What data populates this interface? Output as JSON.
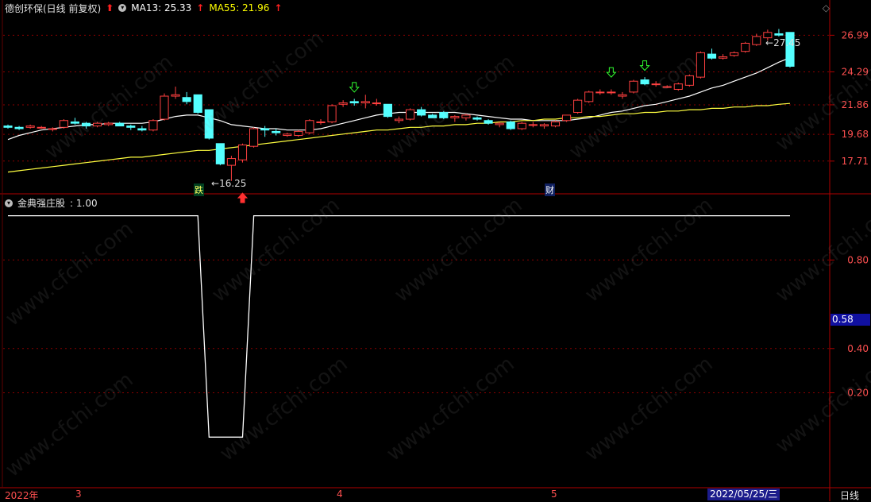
{
  "header": {
    "title": "德创环保(日线 前复权)",
    "ma13_label": "MA13: 25.33",
    "ma55_label": "MA55: 21.96",
    "up_arrow": "↑",
    "settings_icon": "diamond-icon"
  },
  "indicator": {
    "name": "金典强庄股",
    "value": ": 1.00",
    "current_value": "0.58"
  },
  "watermark": "www.cfchi.com",
  "markers": {
    "die": "跌",
    "cai": "财",
    "low_label": "16.25",
    "high_label": "27.45"
  },
  "x_axis": {
    "labels": [
      "2022年",
      "3",
      "4",
      "5"
    ],
    "selected_date": "2022/05/25/三",
    "period": "日线"
  },
  "colors": {
    "up": "#ff4040",
    "down": "#54ffff",
    "ma13": "#ffffff",
    "ma55": "#ffff40",
    "grid": "#8b0000",
    "axis_text": "#ff5050"
  },
  "chart_data": [
    {
      "type": "candlestick",
      "title": "德创环保(日线 前复权)",
      "y_ticks": [
        17.71,
        19.68,
        21.86,
        24.29,
        26.99
      ],
      "ylim": [
        16.0,
        28.3
      ],
      "low": 16.25,
      "high": 27.45,
      "candles": [
        [
          20.3,
          20.4,
          20.1,
          20.2
        ],
        [
          20.2,
          20.3,
          20.0,
          20.1
        ],
        [
          20.2,
          20.4,
          20.1,
          20.3
        ],
        [
          20.2,
          20.3,
          20.1,
          20.2
        ],
        [
          20.1,
          20.2,
          19.9,
          20.1
        ],
        [
          20.2,
          20.8,
          20.1,
          20.7
        ],
        [
          20.6,
          20.9,
          20.4,
          20.5
        ],
        [
          20.5,
          20.6,
          20.1,
          20.3
        ],
        [
          20.3,
          20.6,
          20.2,
          20.5
        ],
        [
          20.4,
          20.6,
          20.3,
          20.5
        ],
        [
          20.5,
          20.6,
          20.3,
          20.3
        ],
        [
          20.3,
          20.4,
          20.0,
          20.2
        ],
        [
          20.1,
          20.3,
          19.9,
          20.0
        ],
        [
          20.0,
          20.8,
          19.9,
          20.7
        ],
        [
          20.8,
          22.7,
          20.7,
          22.5
        ],
        [
          22.5,
          23.2,
          22.3,
          22.6
        ],
        [
          22.4,
          22.8,
          21.9,
          22.1
        ],
        [
          22.6,
          22.6,
          21.2,
          21.3
        ],
        [
          21.5,
          21.5,
          19.3,
          19.4
        ],
        [
          19.0,
          19.0,
          17.4,
          17.5
        ],
        [
          17.4,
          18.1,
          16.25,
          17.9
        ],
        [
          17.8,
          19.0,
          17.6,
          18.9
        ],
        [
          18.8,
          20.2,
          18.7,
          20.1
        ],
        [
          20.1,
          20.3,
          19.5,
          20.0
        ],
        [
          19.9,
          20.1,
          19.6,
          19.8
        ],
        [
          19.6,
          19.8,
          19.5,
          19.7
        ],
        [
          19.6,
          20.0,
          19.5,
          19.9
        ],
        [
          19.8,
          20.8,
          19.7,
          20.7
        ],
        [
          20.6,
          20.8,
          20.4,
          20.6
        ],
        [
          20.6,
          21.9,
          20.5,
          21.8
        ],
        [
          21.9,
          22.2,
          21.7,
          22.0
        ],
        [
          22.1,
          22.3,
          21.8,
          22.0
        ],
        [
          22.0,
          22.6,
          21.6,
          22.1
        ],
        [
          22.0,
          22.3,
          21.8,
          22.0
        ],
        [
          21.9,
          21.9,
          20.9,
          21.0
        ],
        [
          20.7,
          21.0,
          20.5,
          20.8
        ],
        [
          20.8,
          21.6,
          20.7,
          21.5
        ],
        [
          21.5,
          21.7,
          21.0,
          21.1
        ],
        [
          21.1,
          21.2,
          20.9,
          20.9
        ],
        [
          21.3,
          21.4,
          20.8,
          20.9
        ],
        [
          20.9,
          21.1,
          20.6,
          21.0
        ],
        [
          20.9,
          21.2,
          20.7,
          21.1
        ],
        [
          20.9,
          21.0,
          20.7,
          20.8
        ],
        [
          20.7,
          20.8,
          20.4,
          20.5
        ],
        [
          20.4,
          20.6,
          20.2,
          20.5
        ],
        [
          20.6,
          20.7,
          20.0,
          20.1
        ],
        [
          20.1,
          20.6,
          20.0,
          20.5
        ],
        [
          20.4,
          20.6,
          20.2,
          20.4
        ],
        [
          20.3,
          20.5,
          20.1,
          20.4
        ],
        [
          20.3,
          20.7,
          20.2,
          20.6
        ],
        [
          20.7,
          21.1,
          20.6,
          21.1
        ],
        [
          21.3,
          22.3,
          21.2,
          22.2
        ],
        [
          22.1,
          22.9,
          22.0,
          22.8
        ],
        [
          22.8,
          23.0,
          22.6,
          22.8
        ],
        [
          22.8,
          23.0,
          22.6,
          22.8
        ],
        [
          22.5,
          22.8,
          22.3,
          22.6
        ],
        [
          22.8,
          23.7,
          22.7,
          23.6
        ],
        [
          23.7,
          23.9,
          23.3,
          23.4
        ],
        [
          23.4,
          23.6,
          23.2,
          23.4
        ],
        [
          23.2,
          23.3,
          23.1,
          23.2
        ],
        [
          23.0,
          23.5,
          22.9,
          23.4
        ],
        [
          23.3,
          24.1,
          23.2,
          24.0
        ],
        [
          23.9,
          25.8,
          23.8,
          25.7
        ],
        [
          25.6,
          26.0,
          25.2,
          25.3
        ],
        [
          25.3,
          25.6,
          25.2,
          25.4
        ],
        [
          25.5,
          25.8,
          25.4,
          25.7
        ],
        [
          25.8,
          26.5,
          25.7,
          26.4
        ],
        [
          26.3,
          27.1,
          26.2,
          26.9
        ],
        [
          26.8,
          27.4,
          26.6,
          27.2
        ],
        [
          27.1,
          27.45,
          26.9,
          27.0
        ],
        [
          27.2,
          27.2,
          24.6,
          24.7
        ]
      ],
      "series": [
        {
          "name": "MA13",
          "values": [
            19.3,
            19.6,
            19.8,
            20.0,
            20.1,
            20.2,
            20.3,
            20.4,
            20.4,
            20.5,
            20.5,
            20.5,
            20.5,
            20.6,
            20.8,
            21.0,
            21.1,
            21.1,
            20.9,
            20.7,
            20.4,
            20.3,
            20.2,
            20.1,
            20.1,
            20.0,
            20.0,
            20.0,
            20.1,
            20.3,
            20.5,
            20.7,
            20.9,
            21.1,
            21.2,
            21.3,
            21.3,
            21.3,
            21.3,
            21.3,
            21.3,
            21.2,
            21.1,
            21.0,
            20.9,
            20.8,
            20.8,
            20.7,
            20.7,
            20.7,
            20.7,
            20.8,
            20.9,
            21.1,
            21.3,
            21.4,
            21.6,
            21.8,
            21.9,
            22.1,
            22.3,
            22.5,
            22.8,
            23.1,
            23.3,
            23.6,
            23.9,
            24.2,
            24.6,
            25.0,
            25.33
          ]
        },
        {
          "name": "MA55",
          "values": [
            16.9,
            17.0,
            17.1,
            17.2,
            17.3,
            17.4,
            17.5,
            17.6,
            17.7,
            17.8,
            17.9,
            18.0,
            18.0,
            18.1,
            18.2,
            18.3,
            18.4,
            18.5,
            18.5,
            18.6,
            18.7,
            18.8,
            18.9,
            19.0,
            19.1,
            19.2,
            19.3,
            19.4,
            19.5,
            19.6,
            19.7,
            19.8,
            19.9,
            20.0,
            20.0,
            20.1,
            20.2,
            20.2,
            20.3,
            20.3,
            20.4,
            20.4,
            20.5,
            20.5,
            20.6,
            20.6,
            20.7,
            20.7,
            20.8,
            20.8,
            20.9,
            20.9,
            21.0,
            21.0,
            21.1,
            21.2,
            21.2,
            21.3,
            21.3,
            21.4,
            21.4,
            21.5,
            21.5,
            21.6,
            21.6,
            21.7,
            21.7,
            21.8,
            21.8,
            21.9,
            21.96
          ]
        }
      ]
    },
    {
      "type": "line",
      "title": "金典强庄股",
      "y_ticks": [
        0.2,
        0.4,
        0.8
      ],
      "ylim": [
        -0.2,
        1.02
      ],
      "series": [
        {
          "name": "金典强庄股",
          "values": [
            1,
            1,
            1,
            1,
            1,
            1,
            1,
            1,
            1,
            1,
            1,
            1,
            1,
            1,
            1,
            1,
            1,
            1,
            0,
            0,
            0,
            0,
            1,
            1,
            1,
            1,
            1,
            1,
            1,
            1,
            1,
            1,
            1,
            1,
            1,
            1,
            1,
            1,
            1,
            1,
            1,
            1,
            1,
            1,
            1,
            1,
            1,
            1,
            1,
            1,
            1,
            1,
            1,
            1,
            1,
            1,
            1,
            1,
            1,
            1,
            1,
            1,
            1,
            1,
            1,
            1,
            1,
            1,
            1,
            1,
            1
          ]
        }
      ]
    }
  ]
}
